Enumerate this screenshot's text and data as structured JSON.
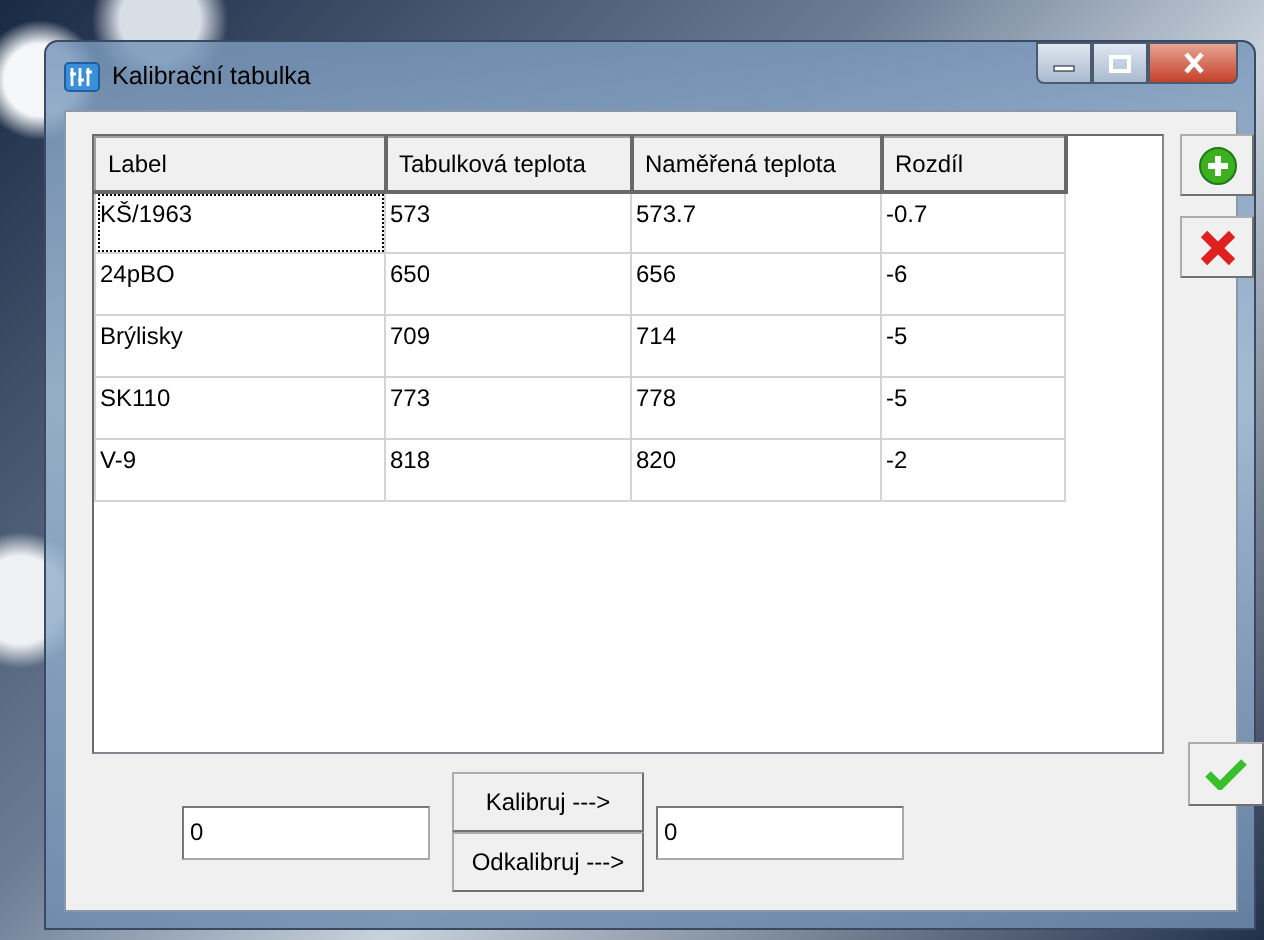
{
  "window": {
    "title": "Kalibrační tabulka"
  },
  "table": {
    "columns": [
      "Label",
      "Tabulková teplota",
      "Naměřená teplota",
      "Rozdíl"
    ],
    "rows": [
      {
        "cells": [
          "KŠ/1963",
          "573",
          "573.7",
          "-0.7"
        ],
        "focused": true
      },
      {
        "cells": [
          "24pBO",
          "650",
          "656",
          "-6"
        ],
        "focused": false
      },
      {
        "cells": [
          "Brýlisky",
          "709",
          "714",
          "-5"
        ],
        "focused": false
      },
      {
        "cells": [
          "SK110",
          "773",
          "778",
          "-5"
        ],
        "focused": false
      },
      {
        "cells": [
          "V-9",
          "818",
          "820",
          "-2"
        ],
        "focused": false
      }
    ]
  },
  "calibration": {
    "input_value": "0",
    "buttons": [
      "Kalibruj --->",
      "Odkalibruj --->"
    ],
    "output_value": "0"
  }
}
